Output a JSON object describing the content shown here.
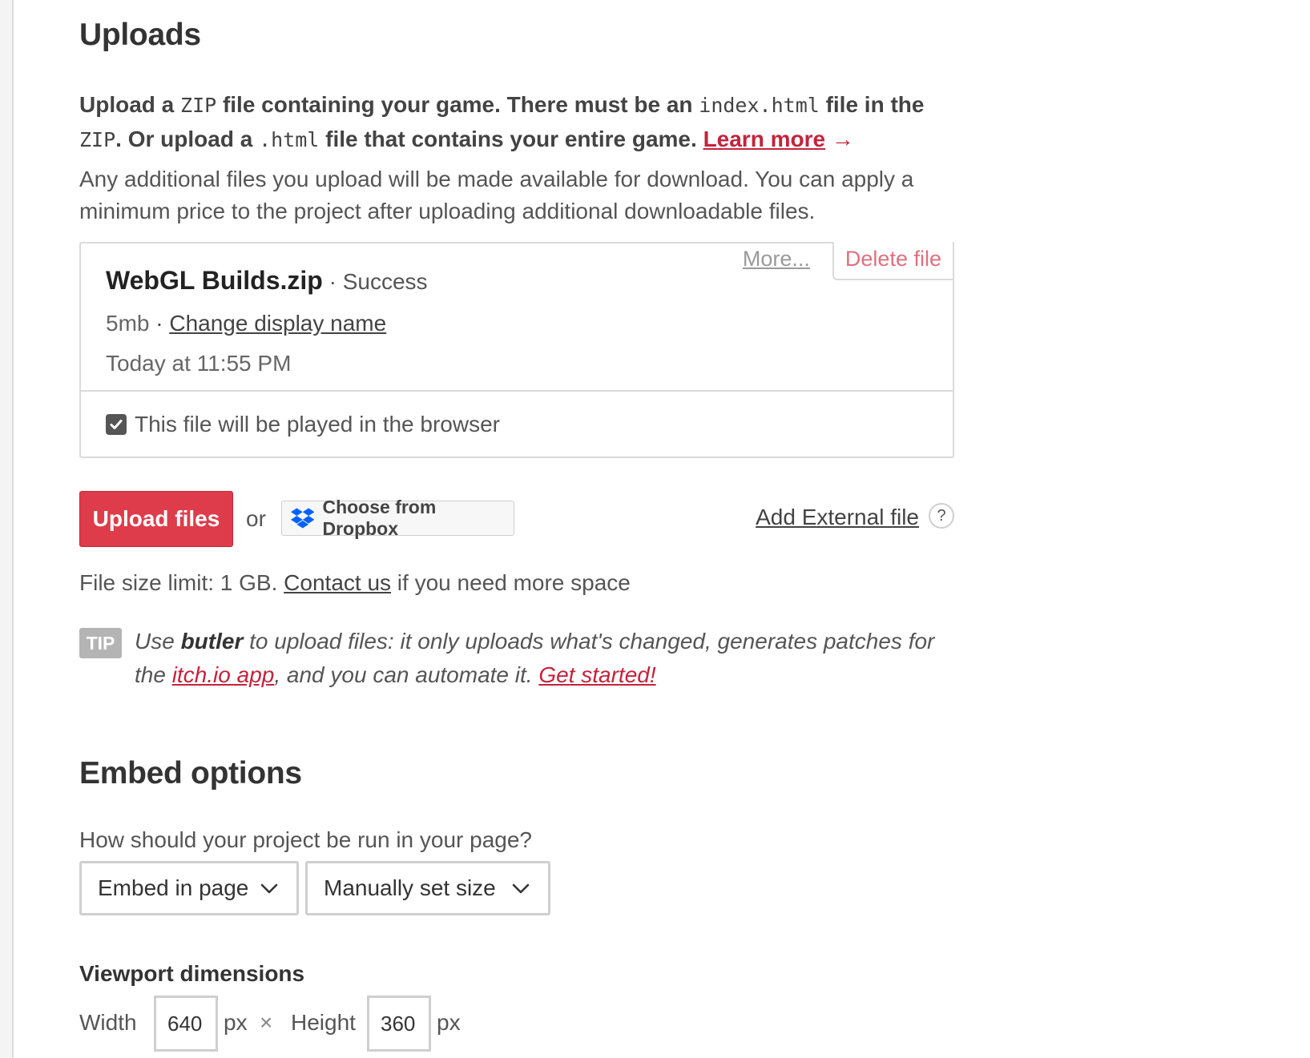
{
  "uploads": {
    "title": "Uploads",
    "intro": {
      "p1": "Upload a ",
      "zip_code": "ZIP",
      "p2": " file containing your game. There must be an ",
      "index_code": "index.html",
      "p3": " file in the ",
      "zip_code2": "ZIP",
      "p4": ". Or upload a ",
      "html_code": ".html",
      "p5": " file that contains your entire game. ",
      "learn_more": "Learn more",
      "arrow": "→"
    },
    "extra_note": "Any additional files you upload will be made available for download. You can apply a minimum price to the project after uploading additional downloadable files."
  },
  "file": {
    "more_label": "More...",
    "delete_label": "Delete file",
    "name": "WebGL Builds.zip",
    "status_sep": " · ",
    "status": "Success",
    "size": "5mb",
    "meta_sep": " · ",
    "change_name": "Change display name",
    "date": "Today at 11:55 PM",
    "browser_checkbox_label": "This file will be played in the browser",
    "browser_checked": true
  },
  "actions": {
    "upload_label": "Upload files",
    "or_label": "or",
    "dropbox_label": "Choose from Dropbox",
    "external_label": "Add External file",
    "help_glyph": "?"
  },
  "size_limit": {
    "p1": "File size limit: 1 GB. ",
    "contact": "Contact us",
    "p2": " if you need more space"
  },
  "tip": {
    "badge": "TIP",
    "p1": "Use ",
    "butler": "butler",
    "p2": " to upload files: it only uploads what's changed, generates patches for the ",
    "app_link": "itch.io app",
    "p3": ", and you can automate it. ",
    "get_started": "Get started!"
  },
  "embed": {
    "title": "Embed options",
    "question": "How should your project be run in your page?",
    "mode_value": "Embed in page",
    "size_value": "Manually set size",
    "viewport_title": "Viewport dimensions",
    "width_label": "Width",
    "width_value": "640",
    "unit": "px",
    "times": "×",
    "height_label": "Height",
    "height_value": "360"
  },
  "colors": {
    "accent": "#de3c4b",
    "link": "#c4233c",
    "dropbox": "#0061fe"
  }
}
